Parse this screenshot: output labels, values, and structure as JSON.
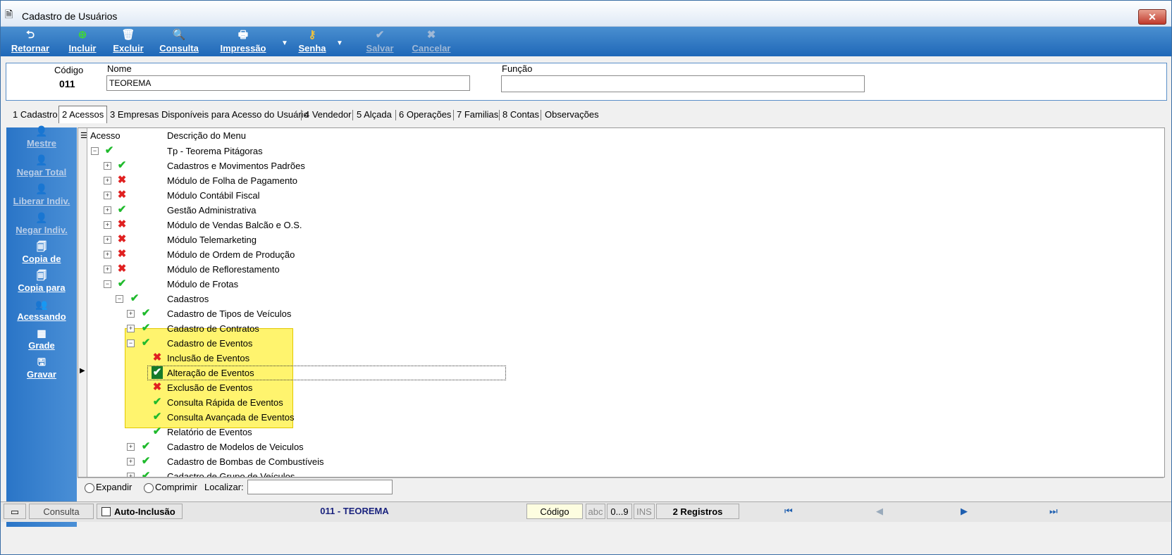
{
  "window": {
    "title": "Cadastro de Usuários"
  },
  "toolbar": {
    "retornar": "Retornar",
    "incluir": "Incluir",
    "excluir": "Excluir",
    "consulta": "Consulta",
    "impressao": "Impressão",
    "senha": "Senha",
    "salvar": "Salvar",
    "cancelar": "Cancelar"
  },
  "header": {
    "codigo_label": "Código",
    "codigo_value": "011",
    "nome_label": "Nome",
    "nome_value": "TEOREMA",
    "funcao_label": "Função",
    "funcao_value": ""
  },
  "tabs": [
    "1 Cadastro",
    "2 Acessos",
    "3 Empresas Disponíveis para Acesso do Usuário",
    "4 Vendedor",
    "5 Alçada",
    "6 Operações",
    "7 Familias",
    "8 Contas",
    "Observações"
  ],
  "sidebar": {
    "mestre": "Mestre",
    "negar_total": "Negar Total",
    "liberar_indiv": "Liberar Indiv.",
    "negar_indiv": "Negar Indiv.",
    "copia_de": "Copia de",
    "copia_para": "Copia para",
    "acessando": "Acessando",
    "grade": "Grade",
    "gravar": "Gravar"
  },
  "grid": {
    "col_acesso": "Acesso",
    "col_descricao": "Descrição do Menu",
    "rows": [
      {
        "level": 0,
        "exp": "minus",
        "status": "ok",
        "label": "Tp - Teorema Pitágoras"
      },
      {
        "level": 1,
        "exp": "plus",
        "status": "ok",
        "label": "Cadastros e Movimentos Padrões"
      },
      {
        "level": 1,
        "exp": "plus",
        "status": "no",
        "label": "Módulo de Folha de Pagamento"
      },
      {
        "level": 1,
        "exp": "plus",
        "status": "no",
        "label": "Módulo Contábil Fiscal"
      },
      {
        "level": 1,
        "exp": "plus",
        "status": "ok",
        "label": "Gestão Administrativa"
      },
      {
        "level": 1,
        "exp": "plus",
        "status": "no",
        "label": "Módulo de Vendas Balcão e O.S."
      },
      {
        "level": 1,
        "exp": "plus",
        "status": "no",
        "label": "Módulo Telemarketing"
      },
      {
        "level": 1,
        "exp": "plus",
        "status": "no",
        "label": "Módulo de Ordem de Produção"
      },
      {
        "level": 1,
        "exp": "plus",
        "status": "no",
        "label": "Módulo de Reflorestamento"
      },
      {
        "level": 1,
        "exp": "minus",
        "status": "ok",
        "label": "Módulo de Frotas"
      },
      {
        "level": 2,
        "exp": "minus",
        "status": "ok",
        "label": "Cadastros"
      },
      {
        "level": 3,
        "exp": "plus",
        "status": "ok",
        "label": "Cadastro de Tipos de Veículos"
      },
      {
        "level": 3,
        "exp": "plus",
        "status": "ok",
        "label": "Cadastro de Contratos"
      },
      {
        "level": 3,
        "exp": "minus",
        "status": "ok",
        "label": "Cadastro de Eventos"
      },
      {
        "level": 4,
        "exp": "",
        "status": "no",
        "label": "Inclusão de Eventos"
      },
      {
        "level": 4,
        "exp": "",
        "status": "ok",
        "label": "Alteração de Eventos",
        "selected": true
      },
      {
        "level": 4,
        "exp": "",
        "status": "no",
        "label": "Exclusão de Eventos"
      },
      {
        "level": 4,
        "exp": "",
        "status": "ok",
        "label": "Consulta Rápida de Eventos"
      },
      {
        "level": 4,
        "exp": "",
        "status": "ok",
        "label": "Consulta Avançada de Eventos"
      },
      {
        "level": 4,
        "exp": "",
        "status": "ok",
        "label": "Relatório de Eventos"
      },
      {
        "level": 3,
        "exp": "plus",
        "status": "ok",
        "label": "Cadastro de Modelos de Veiculos"
      },
      {
        "level": 3,
        "exp": "plus",
        "status": "ok",
        "label": "Cadastro de Bombas de Combustíveis"
      },
      {
        "level": 3,
        "exp": "plus",
        "status": "ok",
        "label": "Cadastro de Grupo de Veículos"
      }
    ]
  },
  "bottom": {
    "expandir": "Expandir",
    "comprimir": "Comprimir",
    "localizar": "Localizar:",
    "localizar_value": ""
  },
  "statusbar": {
    "mode": "Consulta",
    "auto_inclusao": "Auto-Inclusão",
    "record": "011 - TEOREMA",
    "order": "Código",
    "abc": "abc",
    "num": "0...9",
    "ins": "INS",
    "count": "2 Registros"
  }
}
